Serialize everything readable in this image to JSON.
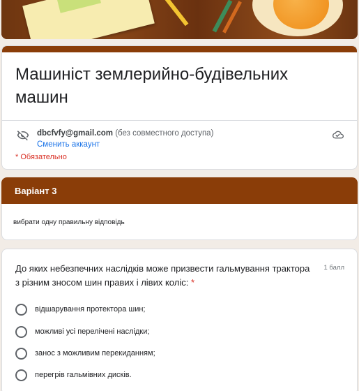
{
  "form": {
    "title": "Машиніст землерийно-будівельних машин",
    "account_email": "dbcfvfy@gmail.com",
    "account_note": "(без совместного доступа)",
    "switch_account": "Сменить аккаунт",
    "required_note": "* Обязательно"
  },
  "section": {
    "title": "Варіант 3",
    "description": "вибрати одну правильну відповідь"
  },
  "question": {
    "text": "До яких небезпечних наслідків може призвести гальмування трактора з різним зносом шин правих і лівих коліс:",
    "required_mark": "*",
    "points": "1 балл",
    "options": [
      "відшарування протектора шин;",
      "можливі усі перелічені наслідки;",
      "занос з можливим перекиданням;",
      "перегрів гальмівних дисків."
    ]
  },
  "icons": {
    "privacy": "eye-off-icon",
    "cloud": "cloud-check-icon"
  },
  "colors": {
    "theme": "#8a3d08",
    "background": "#f2ece6",
    "link": "#1a73e8",
    "required": "#d93025"
  }
}
